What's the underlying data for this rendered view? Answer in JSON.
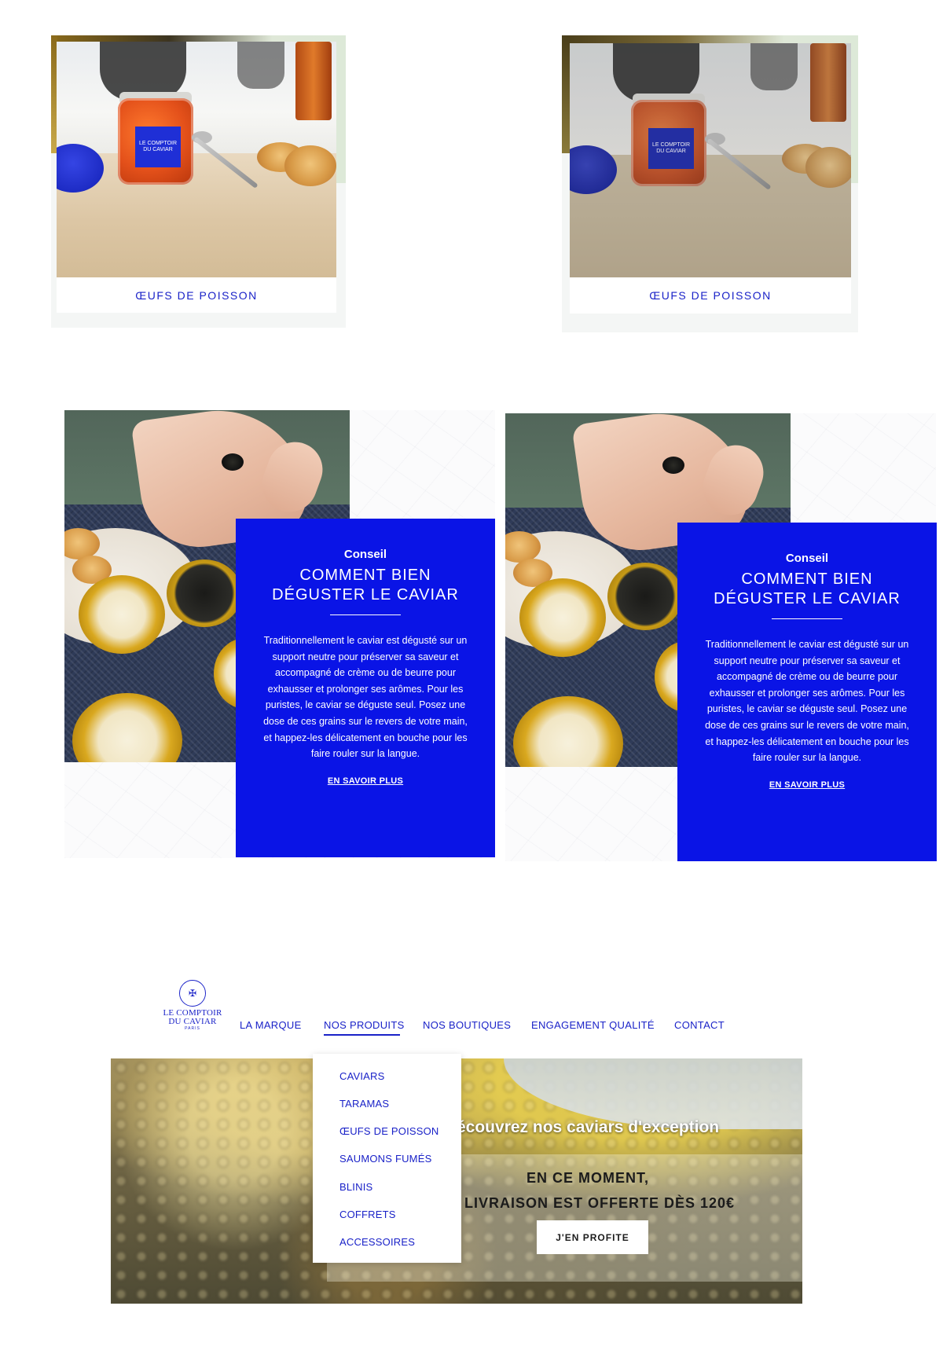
{
  "product_cards": [
    {
      "label": "ŒUFS DE POISSON",
      "jar_brand": "LE COMPTOIR DU CAVIAR"
    },
    {
      "label": "ŒUFS DE POISSON",
      "jar_brand": "LE COMPTOIR DU CAVIAR"
    }
  ],
  "conseil_blocks": [
    {
      "kicker": "Conseil",
      "title_line1": "COMMENT BIEN",
      "title_line2": "DÉGUSTER LE CAVIAR",
      "body": "Traditionnellement le caviar est dégusté sur un support neutre pour préserver sa saveur et accompagné de crème ou de beurre pour exhausser et prolonger ses arômes. Pour les puristes, le caviar se déguste seul. Posez une dose de ces grains sur le revers de votre main, et happez-les délicatement en bouche pour les faire rouler sur la langue.",
      "link": "EN SAVOIR PLUS"
    },
    {
      "kicker": "Conseil",
      "title_line1": "COMMENT BIEN",
      "title_line2": "DÉGUSTER LE CAVIAR",
      "body": "Traditionnellement le caviar est dégusté sur un support neutre pour préserver sa saveur et accompagné de crème ou de beurre pour exhausser et prolonger ses arômes. Pour les puristes, le caviar se déguste seul. Posez une dose de ces grains sur le revers de votre main, et happez-les délicatement en bouche pour les faire rouler sur la langue.",
      "link": "EN SAVOIR PLUS"
    }
  ],
  "header": {
    "logo_line1": "LE COMPTOIR",
    "logo_line2": "DU CAVIAR",
    "logo_sub": "PARIS",
    "nav": [
      {
        "label": "LA MARQUE"
      },
      {
        "label": "NOS PRODUITS",
        "active": true
      },
      {
        "label": "NOS BOUTIQUES"
      },
      {
        "label": "ENGAGEMENT QUALITÉ"
      },
      {
        "label": "CONTACT"
      }
    ]
  },
  "dropdown": {
    "items": [
      "CAVIARS",
      "TARAMAS",
      "ŒUFS DE POISSON",
      "SAUMONS FUMÉS",
      "BLINIS",
      "COFFRETS",
      "ACCESSOIRES"
    ]
  },
  "hero": {
    "tagline": "écouvrez nos caviars d'exception",
    "line1": "EN CE MOMENT,",
    "line2": "LIVRAISON EST OFFERTE DÈS 120€",
    "cta": "J'EN PROFITE"
  },
  "colors": {
    "brand_blue": "#1a22c8",
    "conseil_blue": "#0a14e6",
    "card_frame": "#f4f6f5"
  }
}
